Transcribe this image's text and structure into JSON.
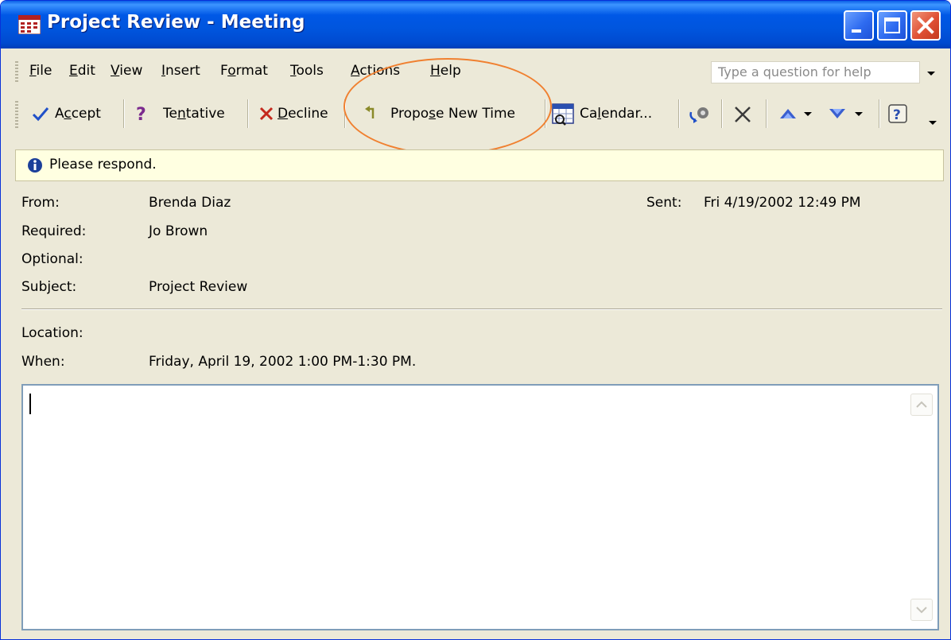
{
  "window": {
    "title": "Project Review - Meeting",
    "icon": "calendar-grid-icon",
    "buttons": [
      "minimize-icon",
      "maximize-icon",
      "close-icon"
    ]
  },
  "menu": {
    "items": [
      "File",
      "Edit",
      "View",
      "Insert",
      "Format",
      "Tools",
      "Actions",
      "Help"
    ],
    "help_placeholder": "Type a question for help"
  },
  "toolbar": {
    "accept": "Accept",
    "tentative": "Tentative",
    "decline": "Decline",
    "propose": "Propose New Time",
    "calendar": "Calendar...",
    "icons": [
      "check-icon",
      "question-icon",
      "x-icon",
      "propose-arrow-icon",
      "calendar-icon",
      "reply-flag-icon",
      "delete-x-icon",
      "previous-item-icon",
      "next-item-icon",
      "help-icon"
    ]
  },
  "info": {
    "icon": "info-icon",
    "text": "Please respond."
  },
  "fields": {
    "from_label": "From:",
    "from_value": "Brenda Diaz",
    "sent_label": "Sent:",
    "sent_value": "Fri 4/19/2002 12:49 PM",
    "required_label": "Required:",
    "required_value": "Jo Brown",
    "optional_label": "Optional:",
    "optional_value": "",
    "subject_label": "Subject:",
    "subject_value": "Project Review",
    "location_label": "Location:",
    "location_value": "",
    "when_label": "When:",
    "when_value": "Friday, April 19, 2002 1:00 PM-1:30 PM."
  },
  "colors": {
    "titlebar": "#0054e3",
    "highlight_ring": "#f08030",
    "infobar": "#ffffe1",
    "window_bg": "#ece9d8"
  }
}
